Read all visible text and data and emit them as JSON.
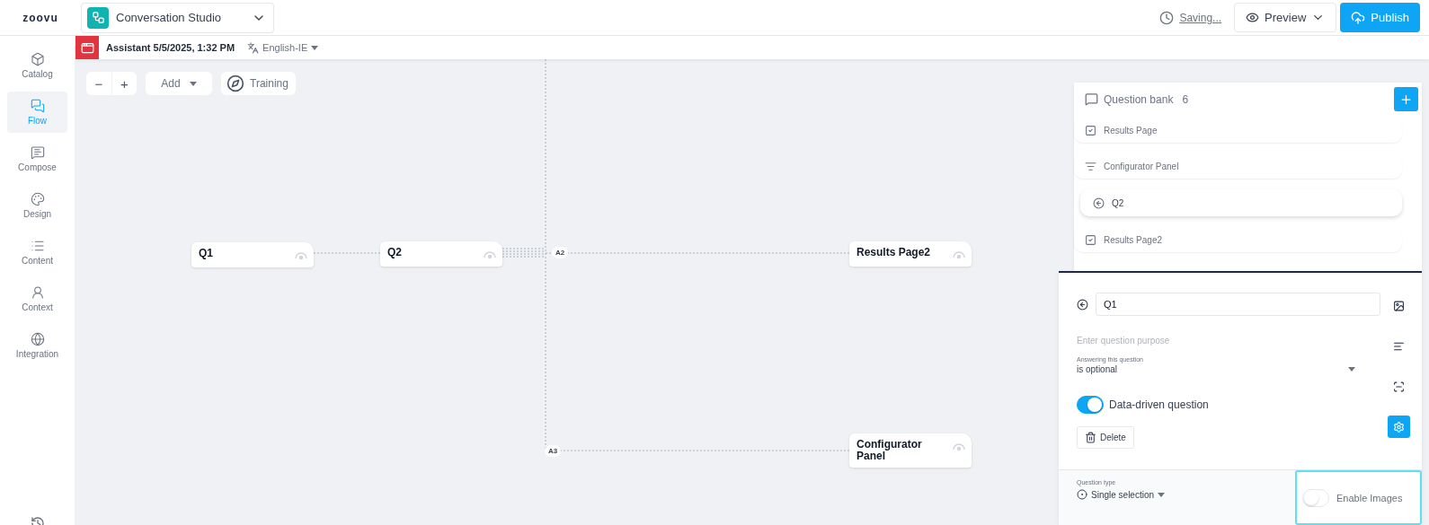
{
  "header": {
    "logo": "zoovu",
    "product": "Conversation Studio",
    "status": "Saving...",
    "preview": "Preview",
    "publish": "Publish"
  },
  "sidebar": {
    "items": [
      {
        "label": "Catalog",
        "selected": false
      },
      {
        "label": "Flow",
        "selected": true
      },
      {
        "label": "Compose",
        "selected": false
      },
      {
        "label": "Design",
        "selected": false
      },
      {
        "label": "Content",
        "selected": false
      },
      {
        "label": "Context",
        "selected": false
      },
      {
        "label": "Integration",
        "selected": false
      }
    ]
  },
  "subheader": {
    "title": "Assistant 5/5/2025, 1:32 PM",
    "language": "English-IE"
  },
  "toolbar": {
    "zoom_out": "−",
    "zoom_in": "+",
    "add": "Add",
    "training": "Training"
  },
  "flow": {
    "nodes": [
      {
        "label": "Q1"
      },
      {
        "label": "Q2"
      },
      {
        "label": "Results Page2"
      },
      {
        "label": "Configurator Panel"
      }
    ],
    "answers": [
      {
        "label": "A2"
      },
      {
        "label": "A3"
      }
    ]
  },
  "question_bank": {
    "title": "Question bank",
    "count": "6",
    "items": [
      {
        "label": "Results Page",
        "kind": "result",
        "selected": false
      },
      {
        "label": "Configurator Panel",
        "kind": "configurator",
        "selected": false
      },
      {
        "label": "Q2",
        "kind": "question",
        "selected": true
      },
      {
        "label": "Results Page2",
        "kind": "result",
        "selected": false
      }
    ]
  },
  "editor": {
    "question_name": "Q1",
    "purpose_placeholder": "Enter question purpose",
    "answering_label": "Answering this question",
    "answering_value": "is optional",
    "data_driven": {
      "label": "Data-driven question",
      "on": true
    },
    "delete": "Delete",
    "tools": [
      {
        "kind": "image",
        "selected": false
      },
      {
        "kind": "text",
        "selected": false
      },
      {
        "kind": "logic",
        "selected": false
      },
      {
        "kind": "settings",
        "selected": true
      }
    ],
    "question_type_label": "Question type",
    "question_type": "Single selection",
    "enable_images": {
      "label": "Enable Images",
      "on": false
    }
  }
}
